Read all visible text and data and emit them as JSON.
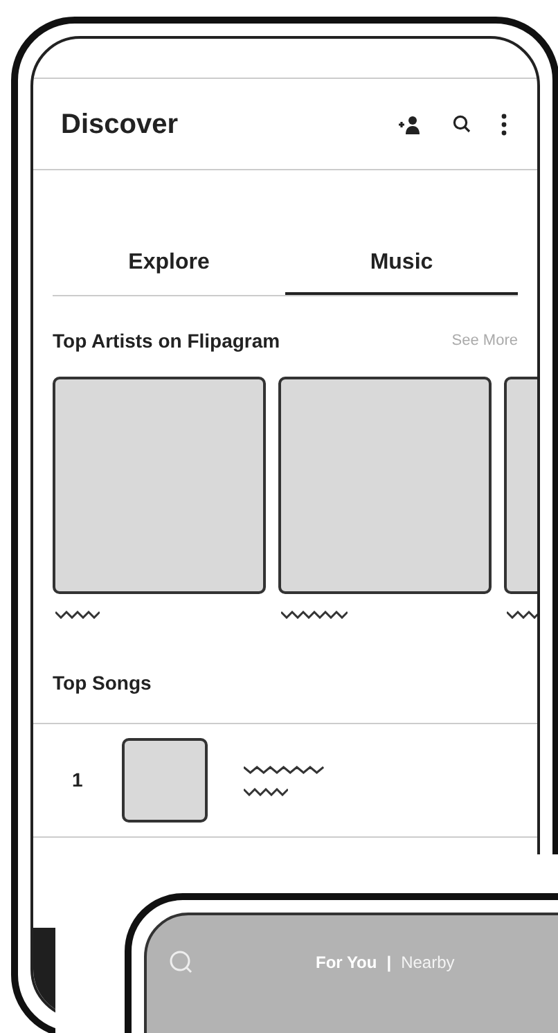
{
  "discover_screen": {
    "title": "Discover",
    "tabs": [
      {
        "label": "Explore",
        "selected": false
      },
      {
        "label": "Music",
        "selected": true
      }
    ],
    "top_artists": {
      "title": "Top Artists on Flipagram",
      "link": "See More"
    },
    "top_songs": {
      "title": "Top Songs",
      "rows": [
        {
          "rank": "1"
        }
      ]
    }
  },
  "feed_screen": {
    "tabs": [
      {
        "label": "For You",
        "selected": true
      },
      {
        "label": "Nearby",
        "selected": false
      }
    ],
    "separator": "|"
  }
}
